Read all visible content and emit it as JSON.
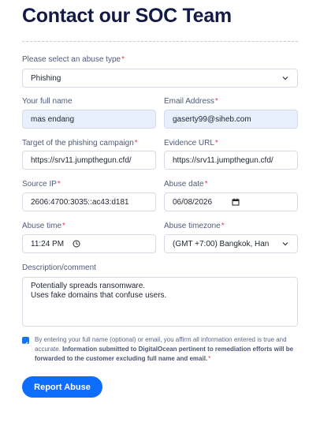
{
  "page": {
    "title": "Contact our SOC Team"
  },
  "form": {
    "abuse_type": {
      "label": "Please select an abuse type",
      "required_mark": "*",
      "value": "Phishing"
    },
    "full_name": {
      "label": "Your full name",
      "value": "mas endang"
    },
    "email": {
      "label": "Email Address",
      "required_mark": "*",
      "value": "gaserty99@siheb.com"
    },
    "target": {
      "label": "Target of the phishing campaign",
      "required_mark": "*",
      "value": "https://srv11.jumpthegun.cfd/"
    },
    "evidence": {
      "label": "Evidence URL",
      "required_mark": "*",
      "value": "https://srv11.jumpthegun.cfd/"
    },
    "source_ip": {
      "label": "Source IP",
      "required_mark": "*",
      "value": "2606:4700:3035::ac43:d181"
    },
    "abuse_date": {
      "label": "Abuse date",
      "required_mark": "*",
      "value": "06/08/2026"
    },
    "abuse_time": {
      "label": "Abuse time",
      "required_mark": "*",
      "value": "11:24 PM"
    },
    "timezone": {
      "label": "Abuse timezone",
      "required_mark": "*",
      "value": "(GMT +7:00) Bangkok, Han"
    },
    "description": {
      "label": "Description/comment",
      "line1": "Potentially spreads ransomware.",
      "line2": "Uses fake domains that confuse users."
    },
    "consent": {
      "checked": true,
      "text_plain": "By entering your full name (optional) or email, you affirm all information entered is true and accurate.",
      "text_bold": "Information submitted to DigitalOcean pertinent to remediation efforts will be forwarded to the customer excluding full name and email.",
      "required_mark": "*"
    },
    "submit_label": "Report Abuse"
  },
  "colors": {
    "accent": "#0d6efd",
    "required": "#e53e4e",
    "autofill": "#e8f0fe",
    "title": "#121a45"
  }
}
